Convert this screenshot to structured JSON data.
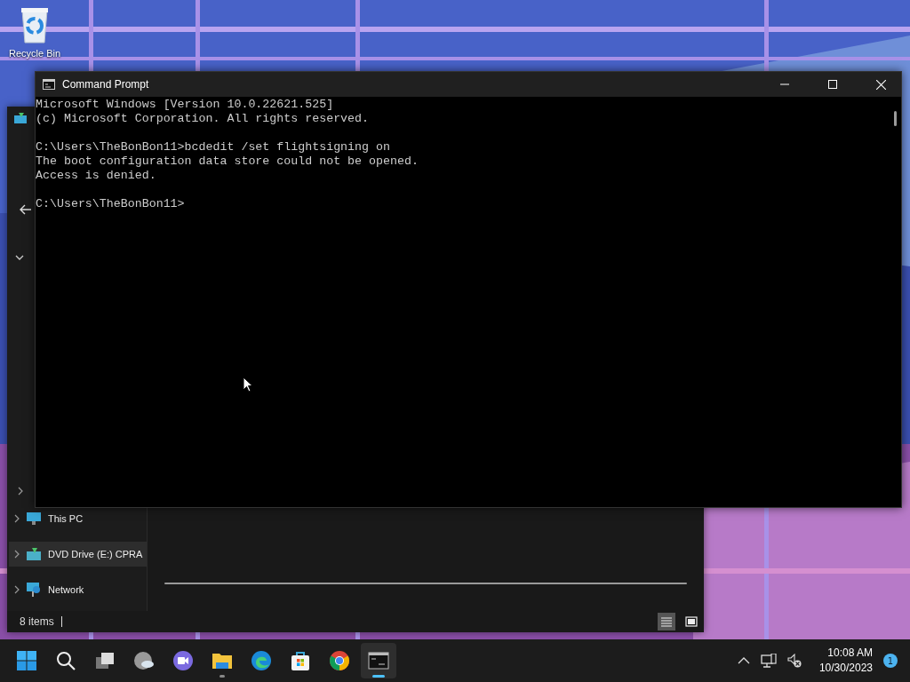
{
  "desktop": {
    "icons": [
      {
        "label": "Recycle Bin"
      }
    ]
  },
  "explorer": {
    "sidebar": {
      "items": [
        {
          "label": "This PC",
          "kind": "pc",
          "selected": false
        },
        {
          "label": "DVD Drive (E:) CPRA",
          "kind": "dvd",
          "selected": true
        },
        {
          "label": "Network",
          "kind": "network",
          "selected": false
        }
      ]
    },
    "status_bar": {
      "item_count": "8 items"
    },
    "view_buttons": [
      {
        "kind": "details",
        "selected": true
      },
      {
        "kind": "tiles",
        "selected": false
      }
    ]
  },
  "command_prompt": {
    "title": "Command Prompt",
    "blocks": [
      [
        "Microsoft Windows [Version 10.0.22621.525]",
        "(c) Microsoft Corporation. All rights reserved."
      ],
      [
        "C:\\Users\\TheBonBon11>bcdedit /set flightsigning on",
        "The boot configuration data store could not be opened.",
        "Access is denied."
      ],
      [
        "C:\\Users\\TheBonBon11>"
      ]
    ]
  },
  "taskbar": {
    "apps": [
      {
        "kind": "start",
        "running": false,
        "selected": false
      },
      {
        "kind": "search",
        "running": false,
        "selected": false
      },
      {
        "kind": "task-view",
        "running": false,
        "selected": false
      },
      {
        "kind": "weather",
        "running": false,
        "selected": false
      },
      {
        "kind": "chat",
        "running": false,
        "selected": false
      },
      {
        "kind": "folder",
        "running": true,
        "selected": false
      },
      {
        "kind": "browser",
        "running": false,
        "selected": false
      },
      {
        "kind": "store",
        "running": false,
        "selected": false
      },
      {
        "kind": "chrome",
        "running": false,
        "selected": false
      },
      {
        "kind": "terminal",
        "running": true,
        "selected": true
      }
    ],
    "clock": {
      "time": "10:08 AM",
      "date": "10/30/2023"
    },
    "notification_count": "1"
  }
}
